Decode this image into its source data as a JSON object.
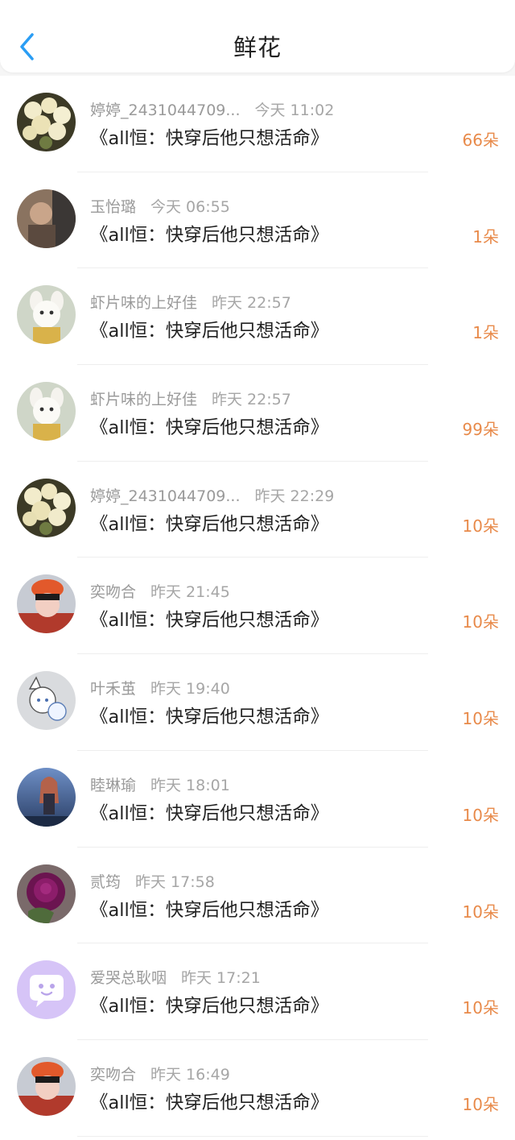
{
  "header": {
    "title": "鲜花"
  },
  "rows": [
    {
      "name": "婷婷_2431044709...",
      "time": "今天 11:02",
      "book": "《all恒：快穿后他只想活命》",
      "count": "66朵",
      "avatar": "flowers-avatar"
    },
    {
      "name": "玉怡璐",
      "time": "今天 06:55",
      "book": "《all恒：快穿后他只想活命》",
      "count": "1朵",
      "avatar": "person-photo-avatar"
    },
    {
      "name": "虾片味的上好佳",
      "time": "昨天 22:57",
      "book": "《all恒：快穿后他只想活命》",
      "count": "1朵",
      "avatar": "bunny-toy-avatar"
    },
    {
      "name": "虾片味的上好佳",
      "time": "昨天 22:57",
      "book": "《all恒：快穿后他只想活命》",
      "count": "99朵",
      "avatar": "bunny-toy-avatar"
    },
    {
      "name": "婷婷_2431044709...",
      "time": "昨天 22:29",
      "book": "《all恒：快穿后他只想活命》",
      "count": "10朵",
      "avatar": "flowers-avatar"
    },
    {
      "name": "奕吻合",
      "time": "昨天 21:45",
      "book": "《all恒：快穿后他只想活命》",
      "count": "10朵",
      "avatar": "orange-hat-avatar"
    },
    {
      "name": "叶禾茧",
      "time": "昨天 19:40",
      "book": "《all恒：快穿后他只想活命》",
      "count": "10朵",
      "avatar": "anime-sketch-avatar"
    },
    {
      "name": "睦琳瑜",
      "time": "昨天 18:01",
      "book": "《all恒：快穿后他只想活命》",
      "count": "10朵",
      "avatar": "anime-girl-avatar"
    },
    {
      "name": "贰筠",
      "time": "昨天 17:58",
      "book": "《all恒：快穿后他只想活命》",
      "count": "10朵",
      "avatar": "rose-avatar"
    },
    {
      "name": "爱哭总耿咽",
      "time": "昨天 17:21",
      "book": "《all恒：快穿后他只想活命》",
      "count": "10朵",
      "avatar": "default-chat-avatar"
    },
    {
      "name": "奕吻合",
      "time": "昨天 16:49",
      "book": "《all恒：快穿后他只想活命》",
      "count": "10朵",
      "avatar": "orange-hat-avatar"
    }
  ],
  "colors": {
    "accent": "#2a9df4",
    "count": "#e88a4a",
    "default_avatar": "#d6c4f7"
  }
}
